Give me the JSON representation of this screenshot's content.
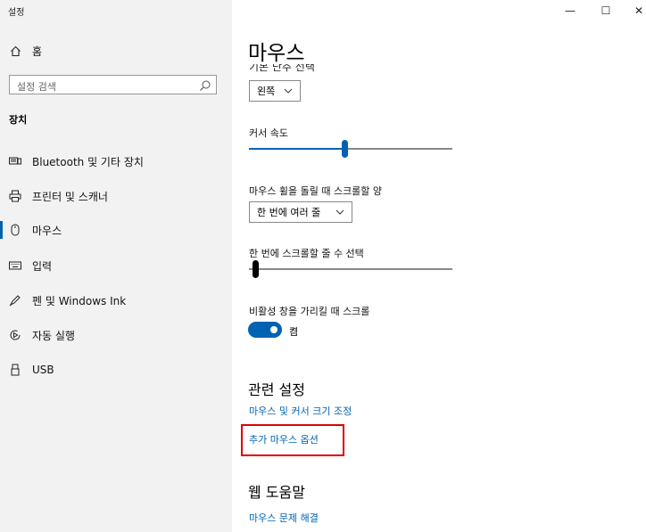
{
  "window": {
    "title": "설정",
    "minimize_glyph": "—",
    "maximize_glyph": "☐",
    "close_glyph": "✕"
  },
  "sidebar": {
    "home_label": "홈",
    "search_placeholder": "설정 검색",
    "section_title": "장치",
    "items": [
      {
        "label": "Bluetooth 및 기타 장치",
        "icon": "bluetooth-devices-icon"
      },
      {
        "label": "프린터 및 스캐너",
        "icon": "printer-icon"
      },
      {
        "label": "마우스",
        "icon": "mouse-icon",
        "selected": true
      },
      {
        "label": "입력",
        "icon": "keyboard-icon"
      },
      {
        "label": "펜 및 Windows Ink",
        "icon": "pen-icon"
      },
      {
        "label": "자동 실행",
        "icon": "autoplay-icon"
      },
      {
        "label": "USB",
        "icon": "usb-icon"
      }
    ]
  },
  "main": {
    "title": "마우스",
    "primary_button_label_clipped": "기본 단추 선택",
    "primary_button_value": "왼쪽",
    "cursor_speed_label": "커서 속도",
    "cursor_speed_fraction": 0.47,
    "wheel_label": "마우스 휠을 돌릴 때 스크롤할 양",
    "wheel_value": "한 번에 여러 줄",
    "lines_label": "한 번에 스크롤할 줄 수 선택",
    "lines_fraction": 0.03,
    "inactive_scroll_label": "비활성 창을 가리킬 때 스크롤",
    "inactive_scroll_state": "켬",
    "related_title": "관련 설정",
    "related_links": [
      "마우스 및 커서 크기 조정",
      "추가 마우스 옵션"
    ],
    "help_title": "웹 도움말",
    "help_links": [
      "마우스 문제 해결"
    ]
  },
  "colors": {
    "accent": "#0063b1",
    "highlight_box": "#e00000",
    "sidebar_bg": "#f2f2f2"
  }
}
